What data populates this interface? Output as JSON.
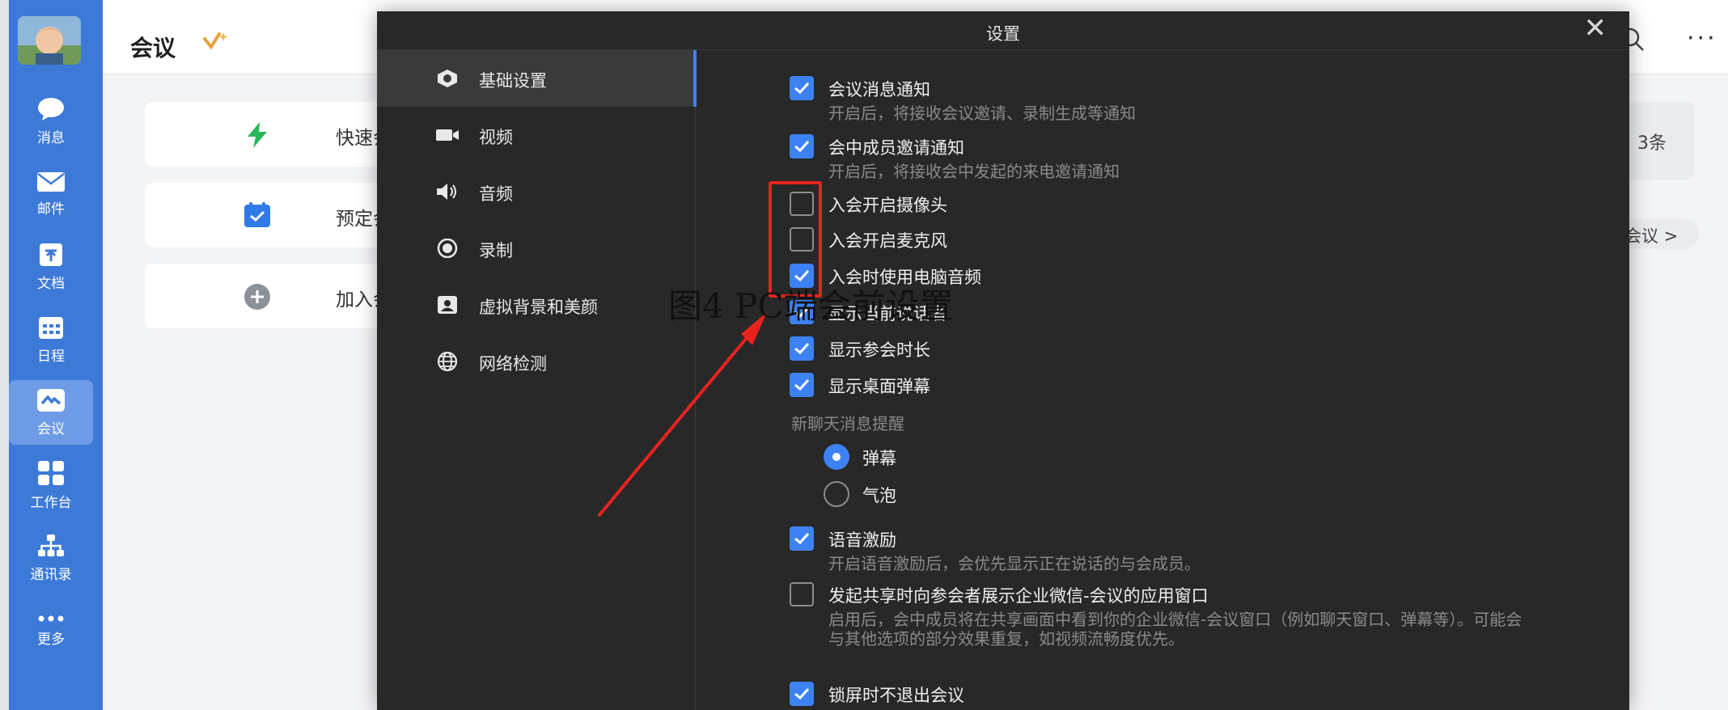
{
  "sidebar": {
    "items": [
      {
        "id": "messages",
        "label": "消息",
        "icon": "chat-bubble-icon"
      },
      {
        "id": "mail",
        "label": "邮件",
        "icon": "mail-icon"
      },
      {
        "id": "docs",
        "label": "文档",
        "icon": "document-icon"
      },
      {
        "id": "calendar",
        "label": "日程",
        "icon": "calendar-icon"
      },
      {
        "id": "meetings",
        "label": "会议",
        "icon": "meeting-icon",
        "active": true
      },
      {
        "id": "workbench",
        "label": "工作台",
        "icon": "grid-icon"
      },
      {
        "id": "contacts",
        "label": "通讯录",
        "icon": "org-chart-icon"
      },
      {
        "id": "more",
        "label": "更多",
        "icon": "more-dots-icon"
      }
    ]
  },
  "main": {
    "title": "会议",
    "actions": [
      {
        "label": "快速会议",
        "icon": "lightning-icon"
      },
      {
        "label": "预定会议",
        "icon": "calendar-check-icon"
      },
      {
        "label": "加入会议",
        "icon": "plus-circle-icon"
      }
    ],
    "info_text": "3条",
    "meeting_link": "会议 >"
  },
  "dialog": {
    "title": "设置",
    "close": "✕",
    "nav": [
      {
        "label": "基础设置",
        "icon": "gear-icon",
        "active": true
      },
      {
        "label": "视频",
        "icon": "video-camera-icon"
      },
      {
        "label": "音频",
        "icon": "speaker-icon"
      },
      {
        "label": "录制",
        "icon": "record-icon"
      },
      {
        "label": "虚拟背景和美颜",
        "icon": "portrait-icon"
      },
      {
        "label": "网络检测",
        "icon": "globe-icon"
      }
    ],
    "options": [
      {
        "label": "会议消息通知",
        "checked": true,
        "desc": "开启后，将接收会议邀请、录制生成等通知"
      },
      {
        "label": "会中成员邀请通知",
        "checked": true,
        "desc": "开启后，将接收会中发起的来电邀请通知"
      },
      {
        "label": "入会开启摄像头",
        "checked": false
      },
      {
        "label": "入会开启麦克风",
        "checked": false
      },
      {
        "label": "入会时使用电脑音频",
        "checked": true
      },
      {
        "label": "显示当前说话者",
        "checked": true
      },
      {
        "label": "显示参会时长",
        "checked": true
      },
      {
        "label": "显示桌面弹幕",
        "checked": true
      }
    ],
    "chat_section": "新聊天消息提醒",
    "chat_options": [
      {
        "label": "弹幕",
        "selected": true
      },
      {
        "label": "气泡",
        "selected": false
      }
    ],
    "lower_options": [
      {
        "label": "语音激励",
        "checked": true,
        "desc": "开启语音激励后，会优先显示正在说话的与会成员。"
      },
      {
        "label": "发起共享时向参会者展示企业微信-会议的应用窗口",
        "checked": false,
        "desc": "启用后，会中成员将在共享画面中看到你的企业微信-会议窗口（例如聊天窗口、弹幕等）。可能会与其他选项的部分效果重复，如视频流畅度优先。"
      },
      {
        "label": "锁屏时不退出会议",
        "checked": true
      }
    ]
  },
  "caption": "图4 PC端会前设置",
  "colors": {
    "rail": "#3d7ad8",
    "accent": "#3d82f5",
    "dialog_bg": "#282828",
    "annotation_red": "#e8231f"
  }
}
